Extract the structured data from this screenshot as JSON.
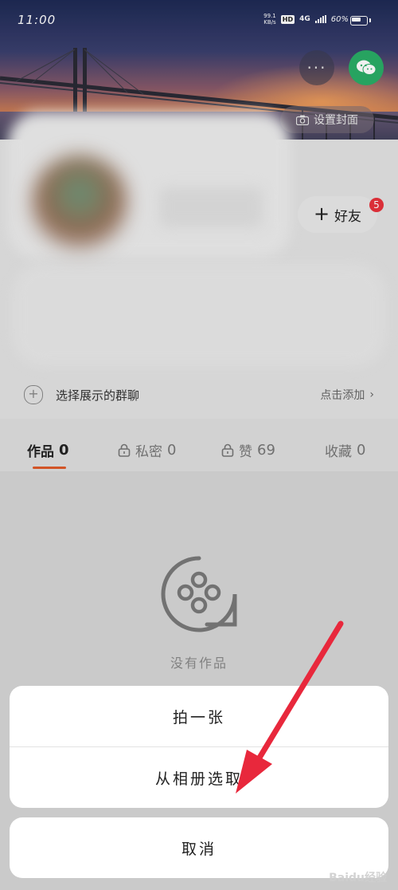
{
  "status_bar": {
    "time": "11:00",
    "net_speed_value": "99.1",
    "net_speed_unit": "KB/s",
    "hd": "HD",
    "network": "4G",
    "battery_pct": "60%"
  },
  "header": {
    "more_label": "···",
    "set_cover_label": "设置封面"
  },
  "profile": {
    "add_friend_label": "好友",
    "friend_badge": "5"
  },
  "group_chat": {
    "label": "选择展示的群聊",
    "action": "点击添加"
  },
  "tabs": [
    {
      "label": "作品",
      "count": "0"
    },
    {
      "label": "私密",
      "count": "0"
    },
    {
      "label": "赞",
      "count": "69"
    },
    {
      "label": "收藏",
      "count": "0"
    }
  ],
  "empty_state": {
    "text": "没有作品"
  },
  "action_sheet": {
    "take_photo": "拍一张",
    "choose_album": "从相册选取",
    "cancel": "取消"
  },
  "watermark": "Baidu经验",
  "colors": {
    "accent_underline": "#e05a2a",
    "wechat_green": "#2aae67",
    "badge_red": "#e8323c",
    "arrow_red": "#e8283c"
  }
}
